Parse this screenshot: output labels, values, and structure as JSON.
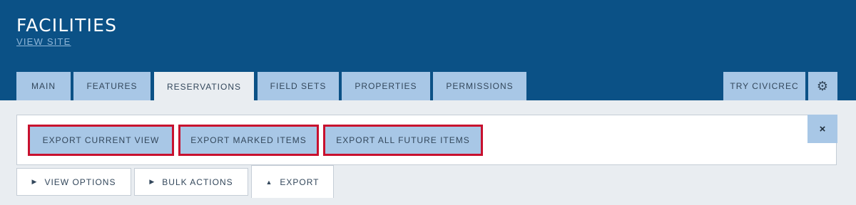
{
  "header": {
    "title": "FACILITIES",
    "view_site": "VIEW SITE"
  },
  "tabs": [
    {
      "label": "MAIN"
    },
    {
      "label": "FEATURES"
    },
    {
      "label": "RESERVATIONS",
      "active": true
    },
    {
      "label": "FIELD SETS"
    },
    {
      "label": "PROPERTIES"
    },
    {
      "label": "PERMISSIONS"
    }
  ],
  "right_tabs": {
    "try_label": "TRY CIVICREC",
    "settings_icon": "gear-icon"
  },
  "export_panel": {
    "buttons": [
      {
        "label": "EXPORT CURRENT VIEW"
      },
      {
        "label": "EXPORT MARKED ITEMS"
      },
      {
        "label": "EXPORT ALL FUTURE ITEMS"
      }
    ],
    "close_label": "×",
    "highlight_color": "#c8102e"
  },
  "subtabs": [
    {
      "arrow": "▶",
      "label": "VIEW OPTIONS"
    },
    {
      "arrow": "▶",
      "label": "BULK ACTIONS"
    },
    {
      "arrow": "▲",
      "label": "EXPORT",
      "active": true
    }
  ],
  "colors": {
    "header_bg": "#0b5186",
    "tab_bg": "#a8c7e6",
    "page_bg": "#e9edf1"
  }
}
